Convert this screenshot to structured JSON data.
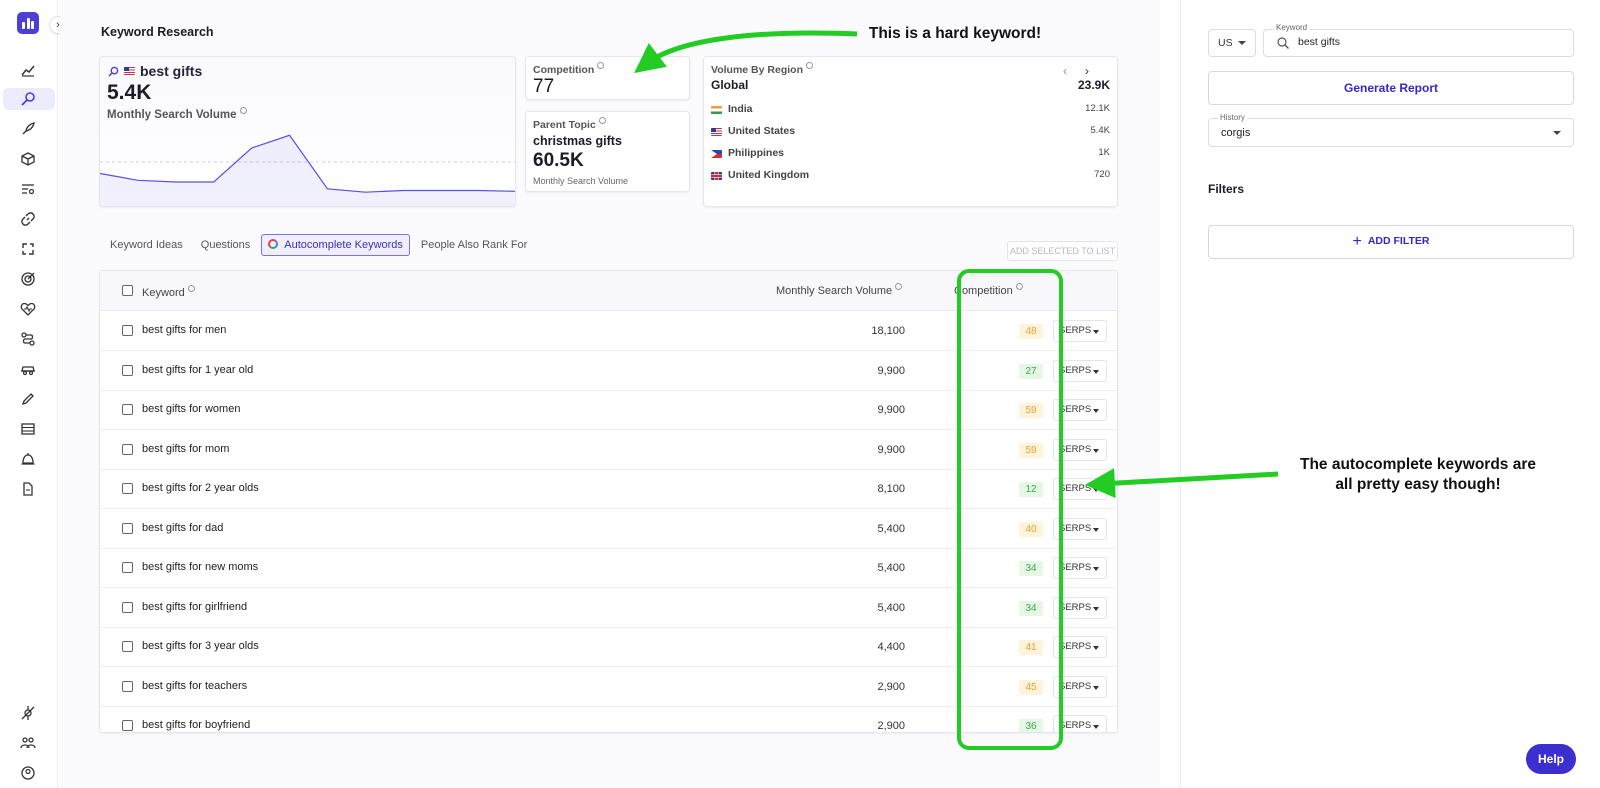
{
  "page": {
    "title": "Keyword Research"
  },
  "summary": {
    "keyword": "best gifts",
    "monthly_volume": "5.4K",
    "monthly_volume_label": "Monthly Search Volume",
    "trend": [
      30,
      22,
      20,
      20,
      60,
      75,
      12,
      8,
      10,
      10,
      10,
      9
    ],
    "competition_label": "Competition",
    "competition_value": "77",
    "parent_topic_label": "Parent Topic",
    "parent_topic": "christmas gifts",
    "parent_volume": "60.5K",
    "parent_volume_label": "Monthly Search Volume"
  },
  "region": {
    "title": "Volume By Region",
    "global_label": "Global",
    "global_value": "23.9K",
    "rows": [
      {
        "country": "India",
        "value": "12.1K",
        "flag": "in"
      },
      {
        "country": "United States",
        "value": "5.4K",
        "flag": "us"
      },
      {
        "country": "Philippines",
        "value": "1K",
        "flag": "ph"
      },
      {
        "country": "United Kingdom",
        "value": "720",
        "flag": "uk"
      }
    ]
  },
  "tabs": [
    {
      "label": "Keyword Ideas",
      "active": false
    },
    {
      "label": "Questions",
      "active": false
    },
    {
      "label": "Autocomplete Keywords",
      "active": true
    },
    {
      "label": "People Also Rank For",
      "active": false
    }
  ],
  "add_to_list": "ADD SELECTED TO LIST",
  "table": {
    "col_keyword": "Keyword",
    "col_volume": "Monthly Search Volume",
    "col_competition": "Competition",
    "serps_label": "SERPS",
    "rows": [
      {
        "keyword": "best gifts for men",
        "volume": "18,100",
        "competition": "48",
        "level": "orange"
      },
      {
        "keyword": "best gifts for 1 year old",
        "volume": "9,900",
        "competition": "27",
        "level": "green"
      },
      {
        "keyword": "best gifts for women",
        "volume": "9,900",
        "competition": "59",
        "level": "orange"
      },
      {
        "keyword": "best gifts for mom",
        "volume": "9,900",
        "competition": "59",
        "level": "orange"
      },
      {
        "keyword": "best gifts for 2 year olds",
        "volume": "8,100",
        "competition": "12",
        "level": "green"
      },
      {
        "keyword": "best gifts for dad",
        "volume": "5,400",
        "competition": "40",
        "level": "orange"
      },
      {
        "keyword": "best gifts for new moms",
        "volume": "5,400",
        "competition": "34",
        "level": "green"
      },
      {
        "keyword": "best gifts for girlfriend",
        "volume": "5,400",
        "competition": "34",
        "level": "green"
      },
      {
        "keyword": "best gifts for 3 year olds",
        "volume": "4,400",
        "competition": "41",
        "level": "orange"
      },
      {
        "keyword": "best gifts for teachers",
        "volume": "2,900",
        "competition": "45",
        "level": "orange"
      },
      {
        "keyword": "best gifts for boyfriend",
        "volume": "2,900",
        "competition": "36",
        "level": "green"
      }
    ]
  },
  "sidebar": {
    "country": "US",
    "keyword_label": "Keyword",
    "keyword_value": "best gifts",
    "generate_label": "Generate Report",
    "history_label": "History",
    "history_value": "corgis",
    "filters_title": "Filters",
    "add_filter_label": "ADD FILTER",
    "help_label": "Help"
  },
  "annotations": {
    "top": "This is a hard keyword!",
    "right_line1": "The autocomplete keywords are",
    "right_line2": "all pretty easy though!"
  },
  "colors": {
    "accent": "#3b2fd0",
    "annotation_green": "#22cc22",
    "competition_orange": "#e89f2c",
    "competition_green": "#3aa84b"
  },
  "rail_icons": [
    "trend-icon",
    "keyword-search-icon",
    "rocket-icon",
    "box-icon",
    "list-search-icon",
    "link-icon",
    "broken-link-icon",
    "target-icon",
    "heart-pulse-icon",
    "route-icon",
    "car-icon",
    "pencil-icon",
    "table-icon",
    "bell-icon",
    "document-icon",
    "settings-plug-icon",
    "team-icon",
    "account-icon"
  ]
}
